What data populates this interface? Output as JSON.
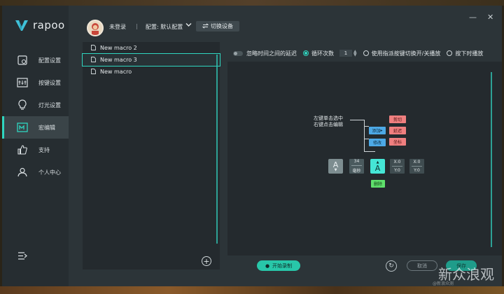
{
  "brand": {
    "name": "rapoo"
  },
  "sidebar": {
    "items": [
      {
        "label": "配置设置",
        "icon": "config-icon"
      },
      {
        "label": "按键设置",
        "icon": "keys-icon"
      },
      {
        "label": "灯光设置",
        "icon": "bulb-icon"
      },
      {
        "label": "宏编辑",
        "icon": "macro-icon",
        "active": true
      },
      {
        "label": "支持",
        "icon": "thumbs-up-icon"
      },
      {
        "label": "个人中心",
        "icon": "user-icon"
      }
    ]
  },
  "topbar": {
    "login": "未登录",
    "separator": "|",
    "config": "配置: 默认配置",
    "switch_device": "切换设备"
  },
  "macros": {
    "items": [
      "New macro 2",
      "New macro 3",
      "New macro"
    ],
    "selected_index": 1
  },
  "options": {
    "ignore_delay": "忽略时间之间的延迟",
    "loop_count": "循环次数",
    "loop_value": "1",
    "toggle_play": "使用指派按键切换开/关播放",
    "hold_play": "按下时播放"
  },
  "diagram": {
    "hint_line1": "左键单击选中",
    "hint_line2": "右键点击编辑",
    "add": "添加",
    "modify": "修改",
    "cut": "剪切",
    "delay": "延迟",
    "copy": "坐标",
    "delete": "删除",
    "key_a": "A",
    "duration_top": "34",
    "duration_bottom": "毫秒",
    "x1": "X:0",
    "y1": "Y:0",
    "x2": "X:0",
    "y2": "Y:0"
  },
  "bottom": {
    "record": "开始录制",
    "cancel": "取消",
    "save": "保存"
  },
  "watermark": {
    "text": "新众浪观",
    "small": "@新浪众测"
  },
  "colors": {
    "accent": "#2fd6c0",
    "record": "#28c7a9"
  }
}
